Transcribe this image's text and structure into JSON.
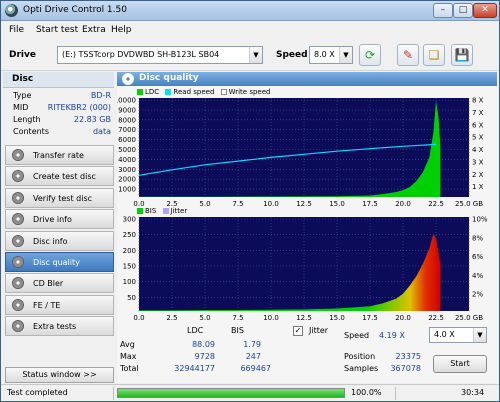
{
  "window": {
    "title": "Opti Drive Control 1.50"
  },
  "menu": [
    "File",
    "Start test",
    "Extra",
    "Help"
  ],
  "toolbar": {
    "drive_label": "Drive",
    "drive_value": "(E:)  TSSTcorp DVDWBD SH-B123L SB04",
    "speed_label": "Speed",
    "speed_value": "8.0 X"
  },
  "disc": {
    "header": "Disc",
    "rows": [
      {
        "k": "Type",
        "v": "BD-R"
      },
      {
        "k": "MID",
        "v": "RITEKBR2 (000)"
      },
      {
        "k": "Length",
        "v": "22.83 GB"
      },
      {
        "k": "Contents",
        "v": "data"
      }
    ]
  },
  "nav": [
    "Transfer rate",
    "Create test disc",
    "Verify test disc",
    "Drive info",
    "Disc info",
    "Disc quality",
    "CD Bler",
    "FE / TE",
    "Extra tests"
  ],
  "nav_active": 5,
  "status_window_label": "Status window >>",
  "panel": {
    "title": "Disc quality"
  },
  "legend_top": {
    "ldc": "LDC",
    "read": "Read speed",
    "write": "Write speed"
  },
  "legend_bottom": {
    "bis": "BIS",
    "jitter": "Jitter"
  },
  "colors": {
    "ldc": "#00d000",
    "read": "#00e0ff",
    "write": "#ffffff",
    "bis": "#00d000",
    "jitter": "#b0a0ff",
    "plot_bg": "#0b0b5a",
    "grid": "#3a5aa6"
  },
  "chart_data": [
    {
      "type": "area",
      "name": "LDC",
      "x_ticks": [
        "0.0",
        "2.5",
        "5.0",
        "7.5",
        "10.0",
        "12.5",
        "15.0",
        "17.5",
        "20.0",
        "22.5",
        "25.0 GB"
      ],
      "y_ticks": [
        "10000",
        "9000",
        "8000",
        "7000",
        "6000",
        "5000",
        "4000",
        "3000",
        "2000",
        "1000"
      ],
      "y2_ticks": [
        "8 X",
        "7 X",
        "6 X",
        "5 X",
        "4 X",
        "3 X",
        "2 X",
        "1 X"
      ],
      "xlim": [
        0,
        25
      ],
      "ylim": [
        0,
        10000
      ],
      "y2lim": [
        0,
        8
      ],
      "ldc": {
        "x": [
          0,
          2.5,
          5,
          7.5,
          10,
          12.5,
          15,
          17.5,
          18.5,
          19.5,
          20,
          20.5,
          21,
          21.5,
          22,
          22.3,
          22.5,
          22.7,
          22.83
        ],
        "y": [
          30,
          30,
          35,
          40,
          50,
          60,
          80,
          150,
          300,
          500,
          700,
          1000,
          1600,
          2500,
          4000,
          6500,
          9728,
          8000,
          5000
        ]
      },
      "read_speed": {
        "x": [
          0,
          2.5,
          5,
          7.5,
          10,
          12.5,
          15,
          17.5,
          20,
          22.5
        ],
        "y": [
          1.75,
          2.2,
          2.6,
          2.9,
          3.2,
          3.45,
          3.7,
          3.9,
          4.1,
          4.25
        ]
      }
    },
    {
      "type": "area",
      "name": "BIS",
      "x_ticks": [
        "0.0",
        "2.5",
        "5.0",
        "7.5",
        "10.0",
        "12.5",
        "15.0",
        "17.5",
        "20.0",
        "22.5",
        "25.0 GB"
      ],
      "y_ticks": [
        "300",
        "250",
        "200",
        "150",
        "100",
        "50"
      ],
      "y2_ticks": [
        "10%",
        "8%",
        "6%",
        "4%",
        "2%"
      ],
      "xlim": [
        0,
        25
      ],
      "ylim": [
        0,
        300
      ],
      "bis": {
        "x": [
          0,
          2.5,
          5,
          7.5,
          10,
          12.5,
          15,
          17.5,
          18.5,
          19.5,
          20,
          20.5,
          21,
          21.5,
          22,
          22.3,
          22.5,
          22.83
        ],
        "y": [
          2,
          2,
          3,
          3,
          4,
          5,
          8,
          15,
          25,
          40,
          55,
          80,
          110,
          150,
          200,
          247,
          230,
          150
        ]
      }
    }
  ],
  "stats": {
    "col_ldc": "LDC",
    "col_bis": "BIS",
    "jitter_label": "Jitter",
    "jitter_checked": "✓",
    "rows": [
      {
        "label": "Avg",
        "ldc": "88.09",
        "bis": "1.79"
      },
      {
        "label": "Max",
        "ldc": "9728",
        "bis": "247"
      },
      {
        "label": "Total",
        "ldc": "32944177",
        "bis": "669467"
      }
    ],
    "speed_label": "Speed",
    "speed_value": "4.19 X",
    "speed_select": "4.0 X",
    "position_label": "Position",
    "position_value": "23375",
    "samples_label": "Samples",
    "samples_value": "367078",
    "start_label": "Start"
  },
  "statusbar": {
    "text": "Test completed",
    "progress": 1.0,
    "progress_text": "100.0%",
    "time": "30:34"
  }
}
